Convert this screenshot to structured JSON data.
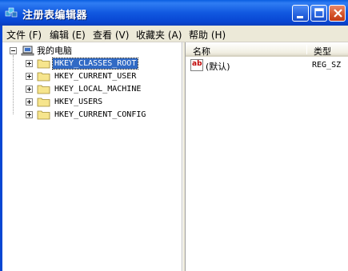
{
  "window": {
    "title": "注册表编辑器",
    "icon": "regedit-icon"
  },
  "titlebar_buttons": [
    "minimize",
    "maximize",
    "close"
  ],
  "menu": [
    {
      "label": "文件 (F)"
    },
    {
      "label": "编辑 (E)"
    },
    {
      "label": "查看 (V)"
    },
    {
      "label": "收藏夹 (A)"
    },
    {
      "label": "帮助 (H)"
    }
  ],
  "tree": {
    "root": "我的电脑",
    "items": [
      {
        "label": "HKEY_CLASSES_ROOT",
        "selected": true
      },
      {
        "label": "HKEY_CURRENT_USER",
        "selected": false
      },
      {
        "label": "HKEY_LOCAL_MACHINE",
        "selected": false
      },
      {
        "label": "HKEY_USERS",
        "selected": false
      },
      {
        "label": "HKEY_CURRENT_CONFIG",
        "selected": false
      }
    ]
  },
  "list": {
    "columns": {
      "name": "名称",
      "type": "类型"
    },
    "rows": [
      {
        "icon": "ab",
        "name": "(默认)",
        "type": "REG_SZ"
      }
    ]
  },
  "colors": {
    "titlebar": "#0846d3",
    "selection": "#316ac5",
    "menubar": "#ece9d8",
    "close_button": "#d6552c"
  }
}
